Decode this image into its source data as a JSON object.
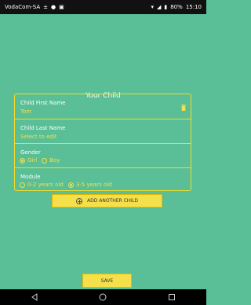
{
  "status_bar": {
    "carrier": "VodaCom-SA",
    "battery": "80%",
    "time": "15:10"
  },
  "page": {
    "title": "Your Child"
  },
  "form": {
    "first_name": {
      "label": "Child First Name",
      "value": "Tom"
    },
    "last_name": {
      "label": "Child Last Name",
      "value": "Select to edit"
    },
    "gender": {
      "label": "Gender",
      "options": [
        "Girl",
        "Boy"
      ],
      "selected": "Girl"
    },
    "module": {
      "label": "Module",
      "options": [
        "0-2 years old",
        "3-5 years old"
      ],
      "selected": "3-5 years old"
    }
  },
  "actions": {
    "add_child": "ADD ANOTHER CHILD",
    "save": "SAVE"
  },
  "icons": {
    "delete": "trash-icon",
    "add": "plus-circle-icon",
    "back": "back-icon",
    "home": "home-icon",
    "recents": "recents-icon"
  },
  "colors": {
    "background": "#5abf96",
    "accent": "#f4e04a",
    "status_bar": "#111111",
    "nav_bar": "#000000"
  }
}
